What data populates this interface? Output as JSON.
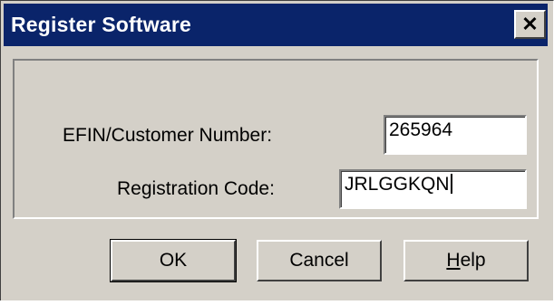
{
  "window": {
    "title": "Register Software",
    "close_glyph": "✕"
  },
  "form": {
    "efin_label": "EFIN/Customer Number:",
    "efin_value": "265964",
    "code_label": "Registration Code:",
    "code_value": "JRLGGKQN"
  },
  "buttons": {
    "ok": "OK",
    "cancel": "Cancel",
    "help_mnemonic": "H",
    "help_rest": "elp"
  },
  "colors": {
    "titlebar": "#0a246a",
    "face": "#d4d0c8"
  },
  "icons": {
    "close": "close-icon"
  }
}
